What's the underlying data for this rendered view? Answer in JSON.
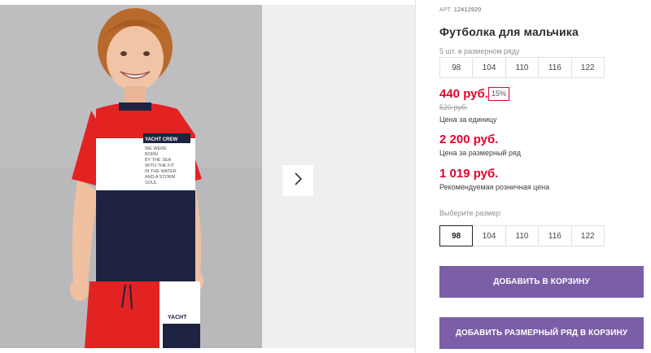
{
  "product": {
    "art_label": "АРТ.",
    "art_number": "12412920",
    "title": "Футболка для мальчика",
    "row_count_text": "5 шт. в размерном ряду",
    "row_sizes": [
      "98",
      "104",
      "110",
      "116",
      "122"
    ],
    "price": "440 руб.",
    "discount": "15%",
    "old_price": "520 руб.",
    "price_unit_caption": "Цена за единицу",
    "set_price": "2 200 руб.",
    "set_price_caption": "Цена за размерный ряд",
    "rrp_price": "1 019 руб.",
    "rrp_caption": "Рекомендуемая розничная цена",
    "choose_size_label": "Выберите размер:",
    "select_sizes": [
      "98",
      "104",
      "110",
      "116",
      "122"
    ],
    "selected_size": "98",
    "add_to_cart": "ДОБАВИТЬ В КОРЗИНУ",
    "add_set_to_cart": "ДОБАВИТЬ РАЗМЕРНЫЙ РЯД В КОРЗИНУ"
  },
  "photo": {
    "shirt_tag": "YACHT CREW",
    "shirt_text": [
      "WE WERE",
      "BORN",
      "BY THE SEA",
      "WITH THE FIT",
      "IN THE WATER",
      "AND A STORM",
      "SOUL"
    ],
    "shorts_text": "YACHT"
  },
  "colors": {
    "accent_price": "#e4002b",
    "button": "#7a5ea6",
    "photo_bg": "#b9b9bb",
    "gallery_bg": "#efefef"
  },
  "icons": {
    "next": "chevron-right-icon"
  }
}
